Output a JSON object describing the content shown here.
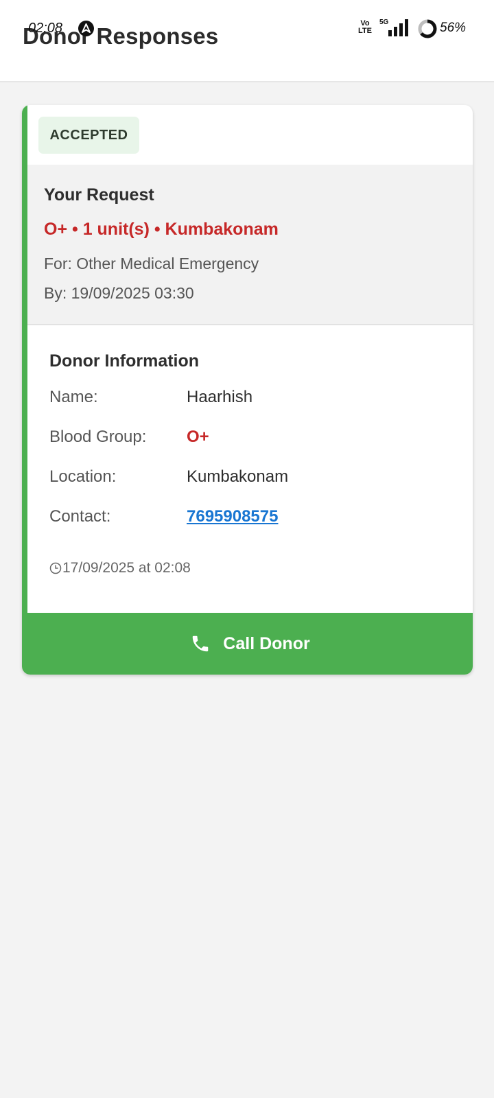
{
  "status_bar": {
    "time": "02:08",
    "network_volte": [
      "Vo",
      "LTE"
    ],
    "network_type": "5G",
    "battery_percent": "56%"
  },
  "header": {
    "title": "Donor Responses"
  },
  "response_card": {
    "status": "ACCEPTED",
    "accent_color": "#4caf50",
    "request": {
      "title": "Your Request",
      "summary": "O+ • 1 unit(s) • Kumbakonam",
      "for_text": "For: Other Medical Emergency",
      "by_text": "By: 19/09/2025 03:30"
    },
    "donor": {
      "title": "Donor Information",
      "name_label": "Name:",
      "name_value": "Haarhish",
      "blood_label": "Blood Group:",
      "blood_value": "O+",
      "location_label": "Location:",
      "location_value": "Kumbakonam",
      "contact_label": "Contact:",
      "contact_value": "7695908575",
      "response_time": "17/09/2025 at 02:08"
    },
    "call_button_label": "Call Donor"
  },
  "icons": {
    "notification": "navigation-arrow-icon",
    "signal": "signal-bars-icon",
    "battery": "battery-ring-icon",
    "clock": "clock-icon",
    "phone": "phone-icon"
  },
  "colors": {
    "accent_green": "#4caf50",
    "badge_bg": "#e8f5e9",
    "blood_red": "#c62828",
    "link_blue": "#1976d2"
  }
}
